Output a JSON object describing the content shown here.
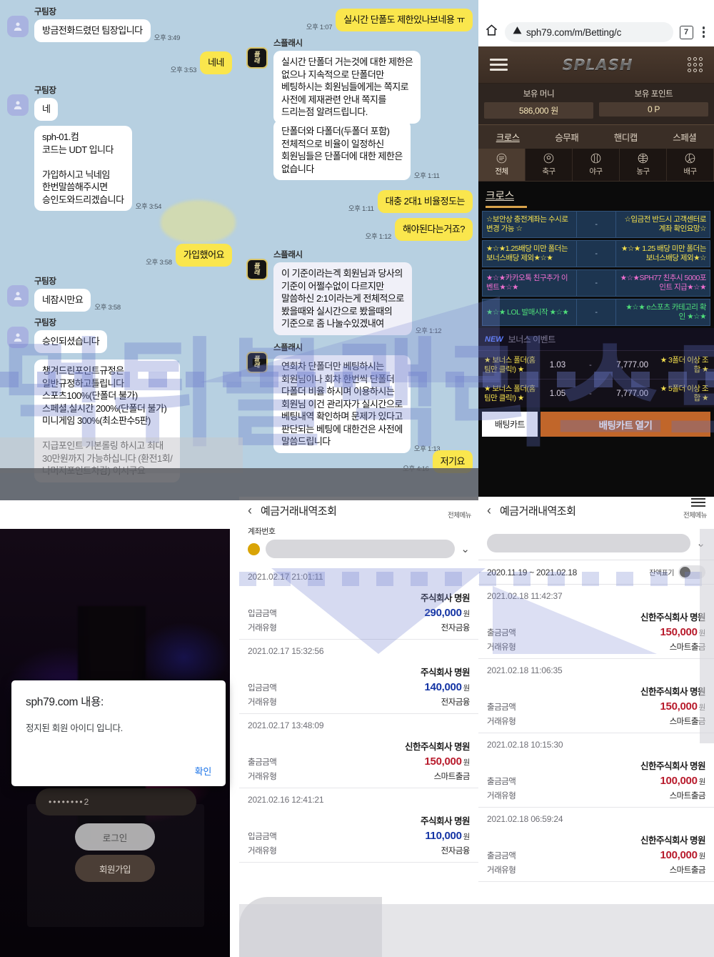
{
  "chat": {
    "left_messages": [
      {
        "type": "in",
        "sender": "구팀장",
        "text": "방금전화드렸던 팀장입니다",
        "time": "오후 3:49",
        "avatar": true
      },
      {
        "type": "out",
        "text": "네네",
        "time": "오후 3:53"
      },
      {
        "type": "in",
        "sender": "구팀장",
        "text": "네",
        "time": "",
        "avatar": true
      },
      {
        "type": "in",
        "sender": "",
        "text": "sph-01.컴\n코드는 UDT 입니다\n\n가입하시고 닉네임\n한번말씀해주시면\n승인도와드리겠습니다",
        "time": "오후 3:54",
        "avatar": false
      },
      {
        "type": "out",
        "text": "가입했어요",
        "time": "오후 3:58"
      },
      {
        "type": "in",
        "sender": "구팀장",
        "text": "네잠시만요",
        "time": "오후 3:58",
        "avatar": true
      },
      {
        "type": "in",
        "sender": "구팀장",
        "text": "승인되셨습니다",
        "time": "",
        "avatar": true
      },
      {
        "type": "in",
        "sender": "",
        "text": "챙겨드린포인트규정은\n일반규정하고틀립니다\n스포츠100%(단폴더 불가)\n스페셜,실시간 200%(단폴더 불가)\n미니게임 300%(최소판수5판)\n\n지급포인트 기본롤링 하시고 최대\n30만원까지 가능하십니다 (환전1회/\n나머지포인트차감) 이시구요",
        "time": "",
        "avatar": false
      }
    ],
    "right_messages": [
      {
        "type": "out",
        "text": "실시간 단폴도 제한있나보네용 ㅠ",
        "time": "오후 1:07"
      },
      {
        "type": "in",
        "sender": "스플래시",
        "text": "실시간 단폴더 거는것에 대한 제한은\n없으나 지속적으로 단폴더만\n베팅하시는 회원님들에게는 쪽지로\n사전에 제재관련 안내 쪽지를\n드리는점 알려드립니다.",
        "time": "",
        "avatar": true
      },
      {
        "type": "in",
        "sender": "",
        "text": "단폴더와 다폴더(두폴더 포함)\n전체적으로 비율이 일정하신\n회원님들은 단폴더에 대한 제한은\n없습니다",
        "time": "오후 1:11",
        "avatar": false
      },
      {
        "type": "out",
        "text": "대충 2대1 비율정도는",
        "time": "오후 1:11"
      },
      {
        "type": "out",
        "text": "해야된다는거죠?",
        "time": "오후 1:12"
      },
      {
        "type": "in",
        "sender": "스플래시",
        "text": "이 기준이라는겍 회원님과 당사의\n기준이 어쩔수없이 다르지만\n말씀하신 2:1이라는게 전체적으로\n봤을때와 실시간으로 봤을때의\n기준으로 좀 나눌수있겠내여",
        "time": "오후 1:12",
        "avatar": true
      },
      {
        "type": "in",
        "sender": "스플래시",
        "text": "연회차 단폴더만 베팅하시는\n회원님이나 회차 한번씩 단폴더\n다폴더 비율 하시며 이용하시는\n회원님 이건 관리자가 실시간으로\n베팅내역 확인하며 문제가 있다고\n판단되는 베팅에 대한건은 사전에\n말씀드립니다",
        "time": "오후 1:13",
        "avatar": true
      },
      {
        "type": "out",
        "text": "저기요",
        "time": "오후 4:16"
      }
    ],
    "avatar_logo_lines": [
      "플",
      "래"
    ]
  },
  "browser": {
    "url": "sph79.com/m/Betting/c",
    "tab_count": "7",
    "icons": {
      "home": "home-icon",
      "warning": "warning-icon",
      "menu": "kebab-menu-icon"
    }
  },
  "site": {
    "logo": "SPLASH",
    "balances": [
      {
        "label": "보유 머니",
        "value": "586,000 원"
      },
      {
        "label": "보유 포인트",
        "value": "0 P"
      }
    ],
    "main_tabs": [
      "크로스",
      "승무패",
      "핸디캡",
      "스페셜"
    ],
    "active_main_tab": "크로스",
    "sport_tabs": [
      "전체",
      "축구",
      "야구",
      "농구",
      "배구"
    ],
    "active_sport_tab": "전체",
    "section_title": "크로스",
    "notice_rows": [
      {
        "left": "☆보안상 충전계좌는 수시로 변경 가능 ☆",
        "mid": "-",
        "right": "☆입금전 반드시 고객센터로 계좌 확인요망☆",
        "color": "yellow"
      },
      {
        "left": "★☆★1.25배당 미만 폴더는 보너스배당 제외★☆★",
        "mid": "-",
        "right": "★☆★ 1.25 배당 미만 폴더는 보너스배당 제외★☆",
        "color": "yellow"
      },
      {
        "left": "★☆★카카오톡 친구추가 이벤트★☆★",
        "mid": "-",
        "right": "★☆★SPH77 친추시 5000포인트 지급★☆★",
        "color": "pink"
      },
      {
        "left": "★☆★ LOL 발매시작 ★☆★",
        "mid": "-",
        "right": "★☆★ e스포츠 카테고리 확인 ★☆★",
        "color": "green"
      }
    ],
    "bonus_header": {
      "badge": "NEW",
      "title": "보너스 이벤트"
    },
    "bonus_rows": [
      {
        "left": "★ 보너스 폴더(홈팀만 클릭!) ★",
        "odd": "1.03",
        "mid": "-",
        "max": "7,777.00",
        "right": "★ 3폴더 이상 조합 ★"
      },
      {
        "left": "★ 보너스 폴더(홈팀만 클릭!) ★",
        "odd": "1.05",
        "mid": "-",
        "max": "7,777.00",
        "right": "★ 5폴더 이상 조합 ★"
      }
    ],
    "cart": {
      "label": "배팅카트",
      "open_label": "배팅카트 열기"
    }
  },
  "login_panel": {
    "password_value": "••••••••2",
    "login_button": "로그인",
    "join_button": "회원가입",
    "alert": {
      "title": "sph79.com 내용:",
      "message": "정지된 회원 아이디 입니다.",
      "ok_label": "확인"
    }
  },
  "bank_mid": {
    "title": "예금거래내역조회",
    "all_menu": "전체메뉴",
    "account_label": "계좌번호",
    "transactions": [
      {
        "datetime": "2021.02.17 21:01:11",
        "party": "주식회사    명원",
        "amount_label": "입금금액",
        "amount": "290,000",
        "won": "원",
        "direction": "in",
        "type_label": "거래유형",
        "type": "전자금융"
      },
      {
        "datetime": "2021.02.17 15:32:56",
        "party": "주식회사    명원",
        "amount_label": "입금금액",
        "amount": "140,000",
        "won": "원",
        "direction": "in",
        "type_label": "거래유형",
        "type": "전자금융"
      },
      {
        "datetime": "2021.02.17 13:48:09",
        "party": "신한주식회사    명원",
        "amount_label": "출금금액",
        "amount": "150,000",
        "won": "원",
        "direction": "out",
        "type_label": "거래유형",
        "type": "스마트출금"
      },
      {
        "datetime": "2021.02.16 12:41:21",
        "party": "주식회사    명원",
        "amount_label": "입금금액",
        "amount": "110,000",
        "won": "원",
        "direction": "in",
        "type_label": "거래유형",
        "type": "전자금융"
      }
    ]
  },
  "bank_right": {
    "title": "예금거래내역조회",
    "all_menu": "전체메뉴",
    "period": "2020.11.19 ~ 2021.02.18",
    "balance_toggle_label": "잔액표기",
    "transactions": [
      {
        "datetime": "2021.02.18 11:42:37",
        "party": "신한주식회사    명원",
        "amount_label": "출금금액",
        "amount": "150,000",
        "won": "원",
        "direction": "out",
        "type_label": "거래유형",
        "type": "스마트출금"
      },
      {
        "datetime": "2021.02.18 11:06:35",
        "party": "신한주식회사    명원",
        "amount_label": "출금금액",
        "amount": "150,000",
        "won": "원",
        "direction": "out",
        "type_label": "거래유형",
        "type": "스마트출금"
      },
      {
        "datetime": "2021.02.18 10:15:30",
        "party": "신한주식회사    명원",
        "amount_label": "출금금액",
        "amount": "100,000",
        "won": "원",
        "direction": "out",
        "type_label": "거래유형",
        "type": "스마트출금"
      },
      {
        "datetime": "2021.02.18 06:59:24",
        "party": "신한주식회사    명원",
        "amount_label": "출금금액",
        "amount": "100,000",
        "won": "원",
        "direction": "out",
        "type_label": "거래유형",
        "type": "스마트출금"
      }
    ]
  },
  "watermark": {
    "text": "먹튀블랙리스트"
  },
  "colors": {
    "chat_bg": "#b7d0e1",
    "bubble_out": "#fae64d",
    "accent_orange": "#c1662a",
    "amount_in": "#1434a4",
    "amount_out": "#b81b2c",
    "alert_link": "#1a73e8"
  }
}
